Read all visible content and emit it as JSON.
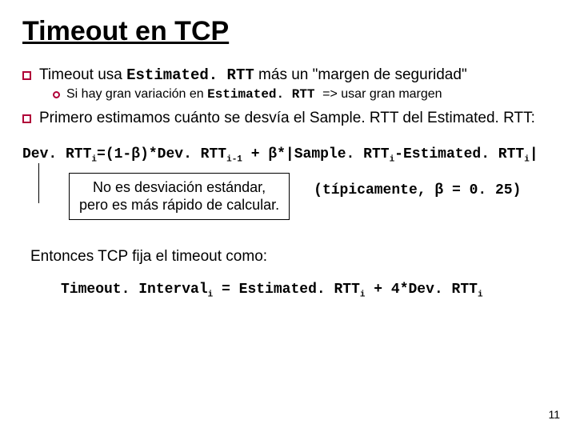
{
  "title": "Timeout en TCP",
  "bullets": {
    "b1_pre": "Timeout usa ",
    "b1_mono": "Estimated. RTT",
    "b1_post": " más un \"margen de seguridad\"",
    "sub1_pre": "Si hay gran variación en ",
    "sub1_mono": "Estimated. RTT ",
    "sub1_post": "=> usar gran margen",
    "b2": "Primero estimamos cuánto se desvía el Sample. RTT del Estimated. RTT:"
  },
  "formula": {
    "lhs": "Dev. RTT",
    "eq": "=(1-",
    "beta": "β",
    "mid1": ")*Dev. RTT",
    "plus": " + ",
    "mid2": "*|Sample. RTT",
    "mid3": "-Estimated. RTT",
    "end": "|",
    "sub_i": "i",
    "sub_im1": "i-1"
  },
  "note": {
    "line1": "No es desviación estándar,",
    "line2": "pero es más rápido de calcular."
  },
  "typical": "(típicamente, β = 0. 25)",
  "entonces": "Entonces TCP fija el timeout como:",
  "formula2": {
    "a": "Timeout. Interval",
    "eq": " = Estimated. RTT",
    "plus": " + 4*Dev. RTT",
    "sub_i": "i"
  },
  "pagenum": "11"
}
